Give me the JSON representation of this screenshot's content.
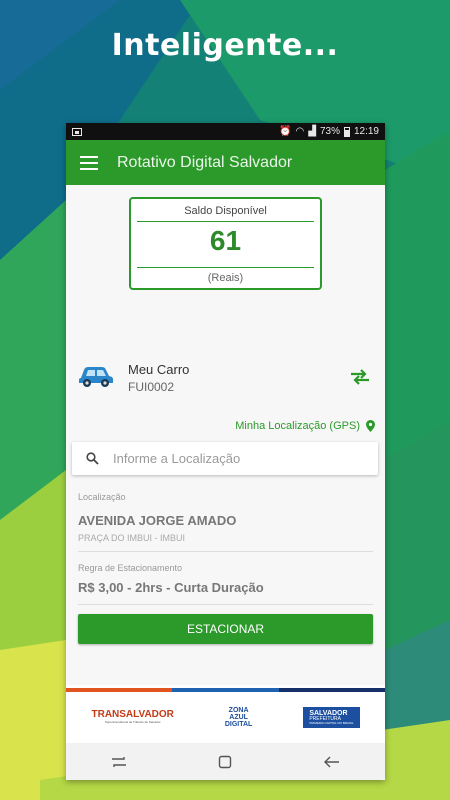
{
  "headline": "Inteligente...",
  "colors": {
    "primary": "#2c9a2a",
    "stripe": [
      "#e1541f",
      "#1f62b0",
      "#16306a"
    ]
  },
  "status_bar": {
    "battery": "73%",
    "time": "12:19"
  },
  "app_bar": {
    "title": "Rotativo Digital Salvador",
    "menu_icon": "menu-icon"
  },
  "balance": {
    "label": "Saldo Disponível",
    "value": "61",
    "unit": "(Reais)"
  },
  "vehicle": {
    "name": "Meu Carro",
    "plate": "FUI0002"
  },
  "gps_link": "Minha Localização (GPS)",
  "search": {
    "placeholder": "Informe a Localização"
  },
  "location": {
    "label": "Localização",
    "street": "AVENIDA JORGE AMADO",
    "sub": "PRAÇA DO IMBUI - IMBUI"
  },
  "rule": {
    "label": "Regra de Estacionamento",
    "value": "R$ 3,00 - 2hrs - Curta Duração"
  },
  "park_button": "ESTACIONAR",
  "logos": {
    "transalvador": "TRANSALVADOR",
    "transalvador_sub": "Superintendência de Trânsito de Salvador",
    "zona_azul": [
      "ZONA",
      "AZUL",
      "DIGITAL"
    ],
    "salvador": "SALVADOR",
    "salvador_sub": "PREFEITURA",
    "salvador_tag": "PRIMEIRA CAPITAL DO BRASIL"
  }
}
